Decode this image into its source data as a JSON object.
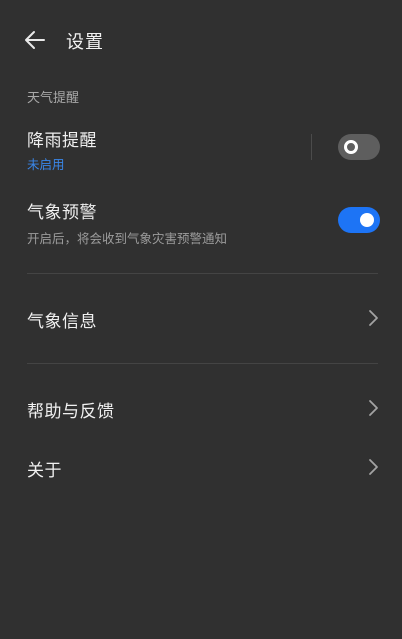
{
  "header": {
    "title": "设置",
    "back_icon": "arrow-left-icon"
  },
  "weather_alerts": {
    "section_title": "天气提醒",
    "rain_reminder": {
      "label": "降雨提醒",
      "status": "未启用",
      "enabled": false
    },
    "weather_warning": {
      "label": "气象预警",
      "description": "开启后，将会收到气象灾害预警通知",
      "enabled": true
    }
  },
  "menu": {
    "weather_info": {
      "label": "气象信息"
    },
    "help_feedback": {
      "label": "帮助与反馈"
    },
    "about": {
      "label": "关于"
    }
  },
  "colors": {
    "background": "#303030",
    "accent": "#1d74f5",
    "status_blue": "#3a86e8"
  }
}
